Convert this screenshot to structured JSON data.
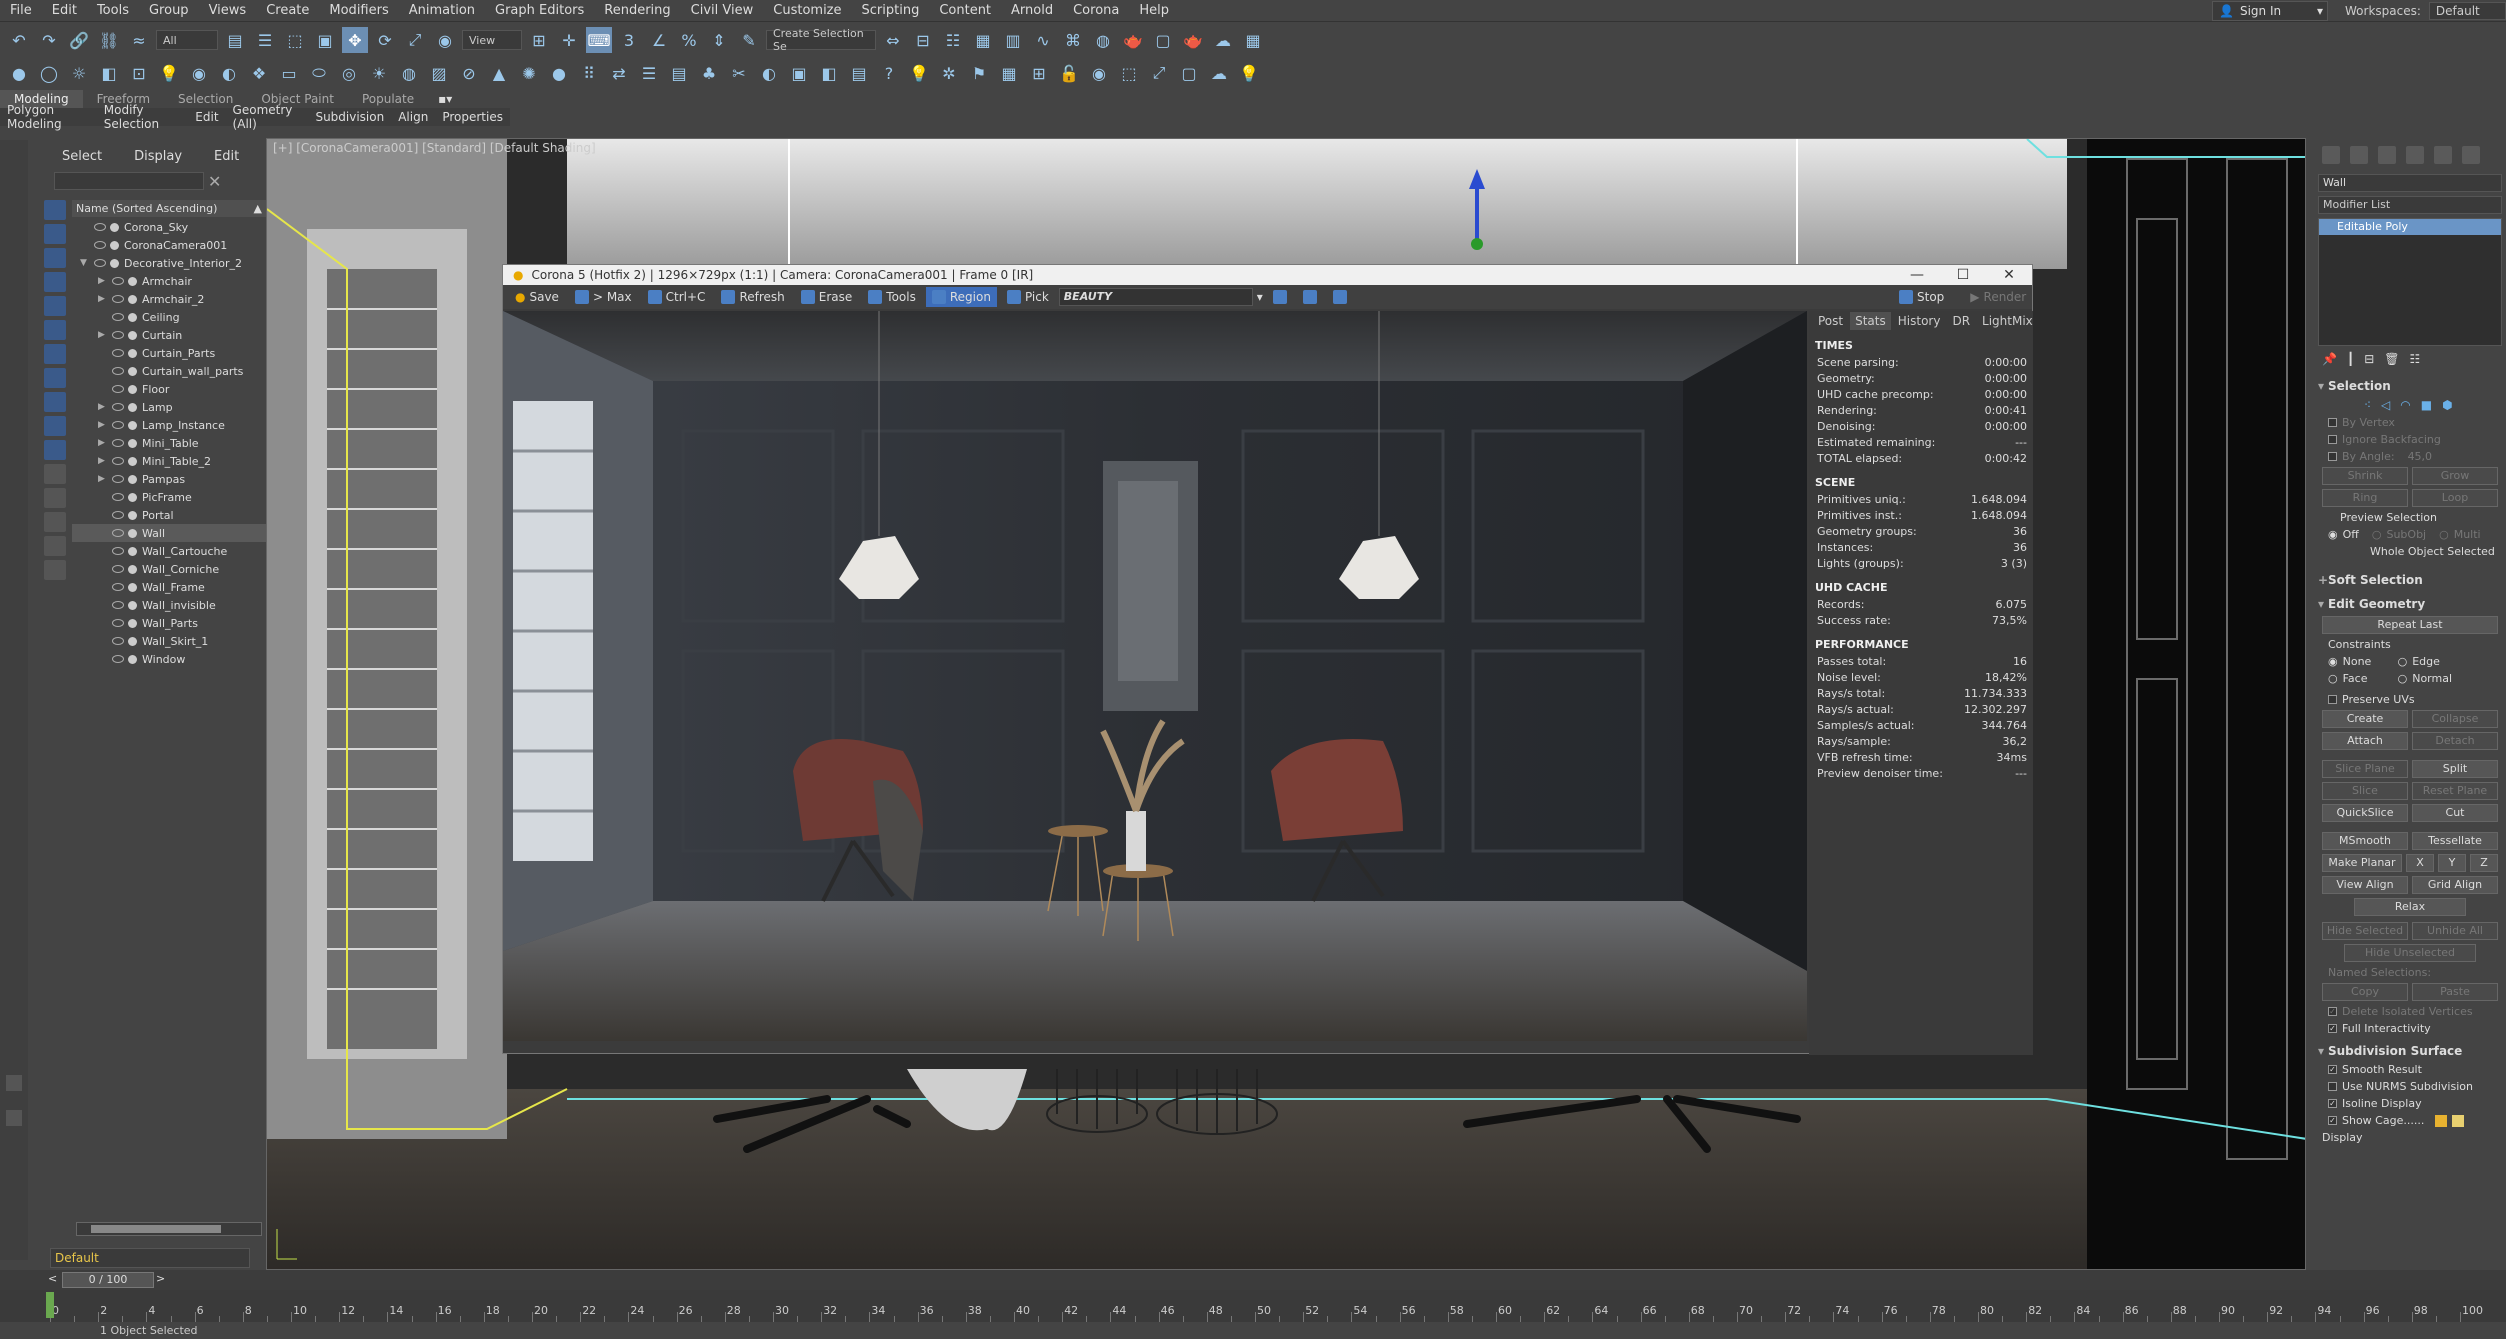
{
  "menubar": {
    "items": [
      "File",
      "Edit",
      "Tools",
      "Group",
      "Views",
      "Create",
      "Modifiers",
      "Animation",
      "Graph Editors",
      "Rendering",
      "Civil View",
      "Customize",
      "Scripting",
      "Content",
      "Arnold",
      "Corona",
      "Help"
    ],
    "signin": "Sign In",
    "workspaces_label": "Workspaces:",
    "workspaces_value": "Default"
  },
  "toolbar": {
    "filter": "All",
    "ref_coord": "View",
    "selection_set": "Create Selection Se"
  },
  "ribbon": {
    "tabs": [
      "Modeling",
      "Freeform",
      "Selection",
      "Object Paint",
      "Populate"
    ],
    "subtabs": [
      "Polygon Modeling",
      "Modify Selection",
      "Edit",
      "Geometry (All)",
      "Subdivision",
      "Align",
      "Properties"
    ]
  },
  "explorer": {
    "menus": [
      "Select",
      "Display",
      "Edit"
    ],
    "header": "Name (Sorted Ascending)",
    "items": [
      {
        "name": "Corona_Sky",
        "depth": 0,
        "expand": ""
      },
      {
        "name": "CoronaCamera001",
        "depth": 0,
        "expand": ""
      },
      {
        "name": "Decorative_Interior_2",
        "depth": 0,
        "expand": "open"
      },
      {
        "name": "Armchair",
        "depth": 1,
        "expand": "closed"
      },
      {
        "name": "Armchair_2",
        "depth": 1,
        "expand": "closed"
      },
      {
        "name": "Ceiling",
        "depth": 1,
        "expand": ""
      },
      {
        "name": "Curtain",
        "depth": 1,
        "expand": "closed"
      },
      {
        "name": "Curtain_Parts",
        "depth": 1,
        "expand": ""
      },
      {
        "name": "Curtain_wall_parts",
        "depth": 1,
        "expand": ""
      },
      {
        "name": "Floor",
        "depth": 1,
        "expand": ""
      },
      {
        "name": "Lamp",
        "depth": 1,
        "expand": "closed"
      },
      {
        "name": "Lamp_Instance",
        "depth": 1,
        "expand": "closed"
      },
      {
        "name": "Mini_Table",
        "depth": 1,
        "expand": "closed"
      },
      {
        "name": "Mini_Table_2",
        "depth": 1,
        "expand": "closed"
      },
      {
        "name": "Pampas",
        "depth": 1,
        "expand": "closed"
      },
      {
        "name": "PicFrame",
        "depth": 1,
        "expand": ""
      },
      {
        "name": "Portal",
        "depth": 1,
        "expand": ""
      },
      {
        "name": "Wall",
        "depth": 1,
        "expand": "",
        "selected": true
      },
      {
        "name": "Wall_Cartouche",
        "depth": 1,
        "expand": ""
      },
      {
        "name": "Wall_Corniche",
        "depth": 1,
        "expand": ""
      },
      {
        "name": "Wall_Frame",
        "depth": 1,
        "expand": ""
      },
      {
        "name": "Wall_invisible",
        "depth": 1,
        "expand": ""
      },
      {
        "name": "Wall_Parts",
        "depth": 1,
        "expand": ""
      },
      {
        "name": "Wall_Skirt_1",
        "depth": 1,
        "expand": ""
      },
      {
        "name": "Window",
        "depth": 1,
        "expand": ""
      }
    ],
    "layer": "Default"
  },
  "viewport": {
    "label": "[+] [CoronaCamera001] [Standard] [Default Shading]"
  },
  "vfb": {
    "title": "Corona 5 (Hotfix 2) | 1296×729px (1:1) | Camera: CoronaCamera001 | Frame 0 [IR]",
    "buttons": [
      "Save",
      "> Max",
      "Ctrl+C",
      "Refresh",
      "Erase",
      "Tools",
      "Region",
      "Pick"
    ],
    "beauty": "BEAUTY",
    "stop": "Stop",
    "render": "Render",
    "panel_tabs": [
      "Post",
      "Stats",
      "History",
      "DR",
      "LightMix"
    ],
    "sections": [
      {
        "title": "TIMES",
        "rows": [
          [
            "Scene parsing:",
            "0:00:00"
          ],
          [
            "Geometry:",
            "0:00:00"
          ],
          [
            "UHD cache precomp:",
            "0:00:00"
          ],
          [
            "Rendering:",
            "0:00:41"
          ],
          [
            "Denoising:",
            "0:00:00"
          ],
          [
            "Estimated remaining:",
            "---"
          ],
          [
            "TOTAL elapsed:",
            "0:00:42"
          ]
        ]
      },
      {
        "title": "SCENE",
        "rows": [
          [
            "Primitives uniq.:",
            "1.648.094"
          ],
          [
            "Primitives inst.:",
            "1.648.094"
          ],
          [
            "Geometry groups:",
            "36"
          ],
          [
            "Instances:",
            "36"
          ],
          [
            "Lights (groups):",
            "3 (3)"
          ]
        ]
      },
      {
        "title": "UHD CACHE",
        "rows": [
          [
            "Records:",
            "6.075"
          ],
          [
            "Success rate:",
            "73,5%"
          ]
        ]
      },
      {
        "title": "PERFORMANCE",
        "rows": [
          [
            "Passes total:",
            "16"
          ],
          [
            "Noise level:",
            "18,42%"
          ],
          [
            "Rays/s total:",
            "11.734.333"
          ],
          [
            "Rays/s actual:",
            "12.302.297"
          ],
          [
            "Samples/s actual:",
            "344.764"
          ],
          [
            "Rays/sample:",
            "36,2"
          ],
          [
            "VFB refresh time:",
            "34ms"
          ],
          [
            "Preview denoiser time:",
            "---"
          ]
        ]
      }
    ]
  },
  "command_panel": {
    "object_name": "Wall",
    "modifier_list": "Modifier List",
    "stack_item": "Editable Poly",
    "selection": {
      "title": "Selection",
      "by_vertex": "By Vertex",
      "ignore_backfacing": "Ignore Backfacing",
      "by_angle": "By Angle:",
      "by_angle_value": "45,0",
      "shrink": "Shrink",
      "grow": "Grow",
      "ring": "Ring",
      "loop": "Loop",
      "preview_selection": "Preview Selection",
      "off": "Off",
      "subobj": "SubObj",
      "multi": "Multi",
      "whole_object": "Whole Object Selected"
    },
    "soft_selection": "Soft Selection",
    "edit_geometry": {
      "title": "Edit Geometry",
      "repeat_last": "Repeat Last",
      "constraints": "Constraints",
      "none": "None",
      "edge": "Edge",
      "face": "Face",
      "normal": "Normal",
      "preserve_uvs": "Preserve UVs",
      "create": "Create",
      "collapse": "Collapse",
      "attach": "Attach",
      "detach": "Detach",
      "slice_plane": "Slice Plane",
      "split": "Split",
      "slice": "Slice",
      "reset_plane": "Reset Plane",
      "quickslice": "QuickSlice",
      "cut": "Cut",
      "msmooth": "MSmooth",
      "tessellate": "Tessellate",
      "make_planar": "Make Planar",
      "x": "X",
      "y": "Y",
      "z": "Z",
      "view_align": "View Align",
      "grid_align": "Grid Align",
      "relax": "Relax",
      "hide_selected": "Hide Selected",
      "unhide_all": "Unhide All",
      "hide_unselected": "Hide Unselected",
      "named_selections": "Named Selections:",
      "copy": "Copy",
      "paste": "Paste",
      "delete_isolated": "Delete Isolated Vertices",
      "full_interactivity": "Full Interactivity"
    },
    "subdivision_surface": {
      "title": "Subdivision Surface",
      "smooth_result": "Smooth Result",
      "use_nurms": "Use NURMS Subdivision",
      "isoline_display": "Isoline Display",
      "show_cage": "Show Cage......",
      "display": "Display"
    }
  },
  "timeline": {
    "frame": "0 / 100",
    "ticks": [
      "0",
      "2",
      "4",
      "6",
      "8",
      "10",
      "12",
      "14",
      "16",
      "18",
      "20",
      "22",
      "24",
      "26",
      "28",
      "30",
      "32",
      "34",
      "36",
      "38",
      "40",
      "42",
      "44",
      "46",
      "48",
      "50",
      "52",
      "54",
      "56",
      "58",
      "60",
      "62",
      "64",
      "66",
      "68",
      "70",
      "72",
      "74",
      "76",
      "78",
      "80",
      "82",
      "84",
      "86",
      "88",
      "90",
      "92",
      "94",
      "96",
      "98",
      "100"
    ]
  },
  "status": {
    "text": "1 Object Selected"
  }
}
